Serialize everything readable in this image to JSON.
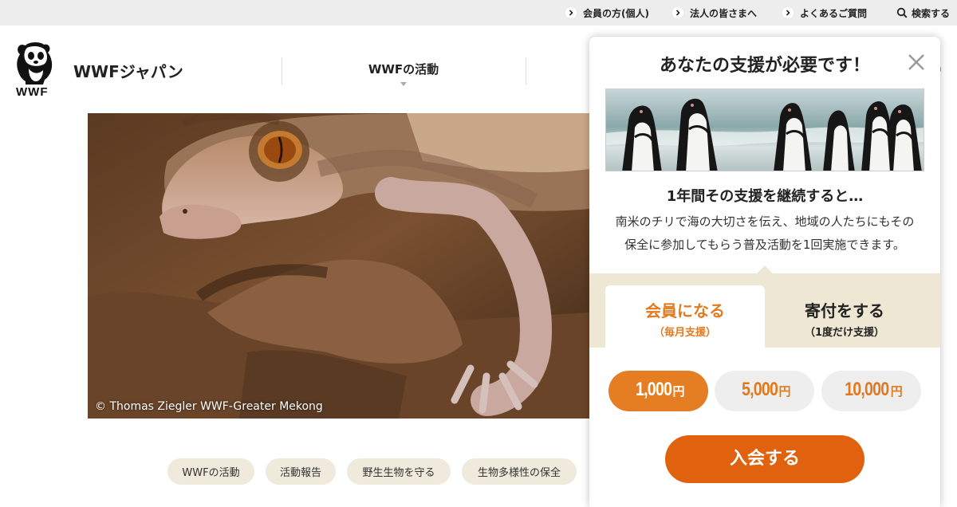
{
  "utility_nav": {
    "members": "会員の方(個人)",
    "corporate": "法人の皆さまへ",
    "faq": "よくあるご質問",
    "search": "検索する"
  },
  "header": {
    "brand": "WWFジャパン",
    "logo_text": "WWF",
    "nav_item": "WWFの活動"
  },
  "hero": {
    "credit": "© Thomas Ziegler  WWF-Greater Mekong"
  },
  "tags": [
    "WWFの活動",
    "活動報告",
    "野生生物を守る",
    "生物多様性の保全"
  ],
  "popup": {
    "title": "あなたの支援が必要です！",
    "subtitle": "1年間その支援を継続すると…",
    "body_line1": "南米のチリで海の大切さを伝え、地域の人たちにもその",
    "body_line2": "保全に参加してもらう普及活動を1回実施できます。",
    "tabs": [
      {
        "label": "会員になる",
        "sub": "（毎月支援）",
        "active": true
      },
      {
        "label": "寄付をする",
        "sub": "（1度だけ支援）",
        "active": false
      }
    ],
    "amounts": [
      {
        "value": "1,000",
        "unit": "円",
        "selected": true
      },
      {
        "value": "5,000",
        "unit": "円",
        "selected": false
      },
      {
        "value": "10,000",
        "unit": "円",
        "selected": false
      }
    ],
    "cta": "入会する"
  },
  "colors": {
    "accent": "#e0620e",
    "accent_light": "#e57e22",
    "tab_bg": "#eee7d3",
    "tag_bg": "#efeadb",
    "util_bg": "#ededed"
  },
  "icons": [
    "chevron-right-icon",
    "search-icon",
    "close-icon",
    "panda-logo-icon",
    "chevron-down-icon"
  ]
}
